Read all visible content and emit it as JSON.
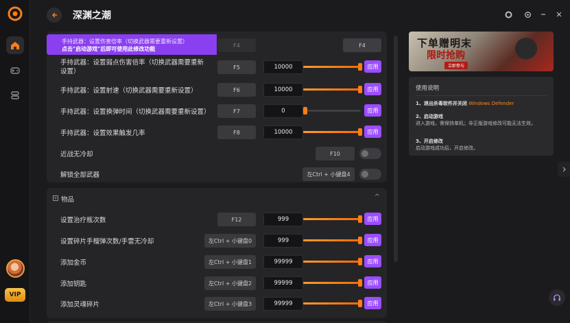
{
  "app": {
    "title": "深渊之潮"
  },
  "tooltip": {
    "line1": "手持武器：设置伤害倍率（切换武器需要重新设置）",
    "line2": "点击\"启动游戏\"后即可使用此修改功能",
    "key": "F4",
    "value": "",
    "apply_key": "F4"
  },
  "weapon_rows": [
    {
      "label": "手持武器：设置弱点伤害倍率（切换武器需要重新设置）",
      "key": "F5",
      "value": "10000",
      "slider": 1.0,
      "apply": "应用"
    },
    {
      "label": "手持武器：设置射速（切换武器需要重新设置）",
      "key": "F6",
      "value": "10000",
      "slider": 1.0,
      "apply": "应用"
    },
    {
      "label": "手持武器：设置换弹时间（切换武器需要重新设置）",
      "key": "F7",
      "value": "0",
      "slider": 0.0,
      "apply": "应用"
    },
    {
      "label": "手持武器：设置效果触发几率",
      "key": "F8",
      "value": "10000",
      "slider": 1.0,
      "apply": "应用"
    }
  ],
  "toggle_rows": [
    {
      "label": "近战无冷却",
      "key": "F10",
      "on": false
    },
    {
      "label": "解锁全部武器",
      "key": "左Ctrl + 小键盘4",
      "on": false
    }
  ],
  "items_section": {
    "title": "物品",
    "rows": [
      {
        "label": "设置治疗瓶次数",
        "key": "F12",
        "value": "999",
        "slider": 1.0,
        "apply": "应用"
      },
      {
        "label": "设置碎片手榴弹次数/手雷无冷却",
        "key": "左Ctrl + 小键盘0",
        "value": "999",
        "slider": 1.0,
        "apply": "应用"
      },
      {
        "label": "添加金币",
        "key": "左Ctrl + 小键盘1",
        "value": "99999",
        "slider": 1.0,
        "apply": "应用"
      },
      {
        "label": "添加钥匙",
        "key": "左Ctrl + 小键盘2",
        "value": "99999",
        "slider": 1.0,
        "apply": "应用"
      },
      {
        "label": "添加灵魂碎片",
        "key": "左Ctrl + 小键盘3",
        "value": "99999",
        "slider": 1.0,
        "apply": "应用"
      }
    ]
  },
  "banner": {
    "line1": "下单赠明末",
    "line2": "限时抢购",
    "tag": "立即参与"
  },
  "instructions": {
    "title": "使用说明",
    "step1_title": "1、退出杀毒软件并关闭",
    "step1_highlight": "Windows Defender",
    "step2_title": "2、启动游戏",
    "step2_desc": "进入游戏，需保持单机；非正版游戏修改可能无法生效。",
    "step3_title": "3、开启修改",
    "step3_desc": "启动游戏成功后，开启修改。"
  },
  "rail": {
    "vip_label": "VIP"
  },
  "colors": {
    "accent_purple": "#9b4dff",
    "accent_orange": "#ff7d17",
    "bg": "#1b1b1d"
  }
}
